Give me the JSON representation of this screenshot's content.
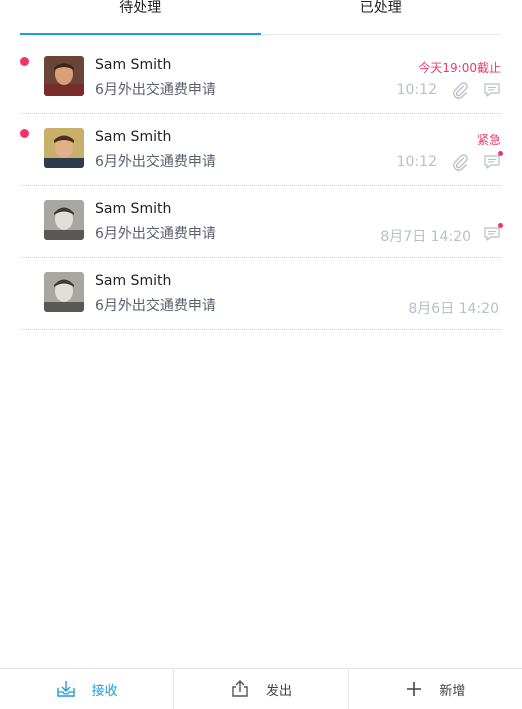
{
  "tabs": [
    {
      "label": "待处理",
      "active": true
    },
    {
      "label": "已处理",
      "active": false
    }
  ],
  "items": [
    {
      "name": "Sam Smith",
      "subject": "6月外出交通费申请",
      "tag": "今天19:00截止",
      "time": "10:12",
      "unread": true,
      "attachment": true,
      "comment_badge": false
    },
    {
      "name": "Sam Smith",
      "subject": "6月外出交通费申请",
      "tag": "紧急",
      "time": "10:12",
      "unread": true,
      "attachment": true,
      "comment_badge": true
    },
    {
      "name": "Sam Smith",
      "subject": "6月外出交通费申请",
      "tag": "",
      "time": "8月7日 14:20",
      "unread": false,
      "attachment": false,
      "comment_badge": true
    },
    {
      "name": "Sam Smith",
      "subject": "6月外出交通费申请",
      "tag": "",
      "time": "8月6日 14:20",
      "unread": false,
      "attachment": false,
      "comment_badge": false
    }
  ],
  "bottom_nav": [
    {
      "label": "接收",
      "icon": "inbox-download-icon",
      "active": true
    },
    {
      "label": "发出",
      "icon": "share-upload-icon",
      "active": false
    },
    {
      "label": "新增",
      "icon": "plus-icon",
      "active": false
    }
  ],
  "colors": {
    "accent": "#1e9fd8",
    "alert": "#f0346a",
    "muted": "#b8bfca"
  }
}
